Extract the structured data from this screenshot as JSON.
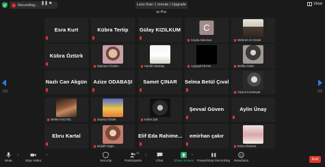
{
  "topbar": {
    "recording_label": "Recording...",
    "timer_text": "Less than 1 minute | Upgrade to Pro",
    "view_label": "View"
  },
  "pager": {
    "left": "2/3",
    "right": "2/3"
  },
  "tiles": [
    {
      "name": "Esra Kurt",
      "label": "",
      "kind": "name"
    },
    {
      "name": "Kübra Tertip",
      "label": "",
      "kind": "name"
    },
    {
      "name": "Gülay  KIZILKUM",
      "label": "",
      "kind": "name"
    },
    {
      "name": "",
      "label": "Ceyda Akduman",
      "kind": "avatar",
      "initial": "C"
    },
    {
      "name": "",
      "label": "Mehmet Alı Ozturk",
      "kind": "photo",
      "photo": "man-cap"
    },
    {
      "name": "Kübra Öztürk",
      "label": "",
      "kind": "name"
    },
    {
      "name": "",
      "label": "Büşranur Özdem",
      "kind": "photo",
      "photo": "woman-hijab"
    },
    {
      "name": "",
      "label": "Handil Altunbaş",
      "kind": "photo",
      "photo": "woman-dance"
    },
    {
      "name": "",
      "label": "Ayşegül CİHAN",
      "kind": "black"
    },
    {
      "name": "",
      "label": "Melike Gülen",
      "kind": "photo",
      "photo": "woman-dark"
    },
    {
      "name": "Nazlı Can Akgün",
      "label": "",
      "kind": "name"
    },
    {
      "name": "Azize ODABAŞI",
      "label": "",
      "kind": "name"
    },
    {
      "name": "Samet ÇINAR",
      "label": "",
      "kind": "name"
    },
    {
      "name": "Selma Betül Çıvak",
      "label": "",
      "kind": "name"
    },
    {
      "name": "",
      "label": "Aleyna Kocabıçak",
      "kind": "photo",
      "photo": "woman-bw"
    },
    {
      "name": "",
      "label": "Melike KOCAEL",
      "kind": "photo",
      "photo": "woman-hat"
    },
    {
      "name": "",
      "label": "Zeynep Öztürk",
      "kind": "photo",
      "photo": "cartoon"
    },
    {
      "name": "",
      "label": "Kübra Şak",
      "kind": "photo",
      "photo": "woman-bw2"
    },
    {
      "name": "Şevval Güven",
      "label": "",
      "kind": "name"
    },
    {
      "name": "Aylin Ünay",
      "label": "",
      "kind": "name"
    },
    {
      "name": "Ebru Kartal",
      "label": "",
      "kind": "name"
    },
    {
      "name": "",
      "label": "Mukdif Girgin",
      "kind": "photo",
      "photo": "woman-portrait"
    },
    {
      "name": "Elif  Eda  Rahime...",
      "label": "",
      "kind": "name"
    },
    {
      "name": "emirhan çakır",
      "label": "",
      "kind": "name"
    },
    {
      "name": "",
      "label": "Esma Özdemir",
      "kind": "photo",
      "photo": "woman-bed"
    }
  ],
  "toolbar": {
    "mute": "Mute",
    "stop_video": "Stop Video",
    "security": "Security",
    "participants": "Participants",
    "participants_count": "70",
    "chat": "Chat",
    "share_screen": "Share Screen",
    "pause_recording": "Pause/Stop Recording",
    "reactions": "Reactions",
    "end": "End"
  },
  "colors": {
    "tile_bg": "#222222",
    "page_bg": "#1a1a1a",
    "accent_blue": "#2f7dd6",
    "share_green": "#2fa36a",
    "end_red": "#d9382f"
  }
}
